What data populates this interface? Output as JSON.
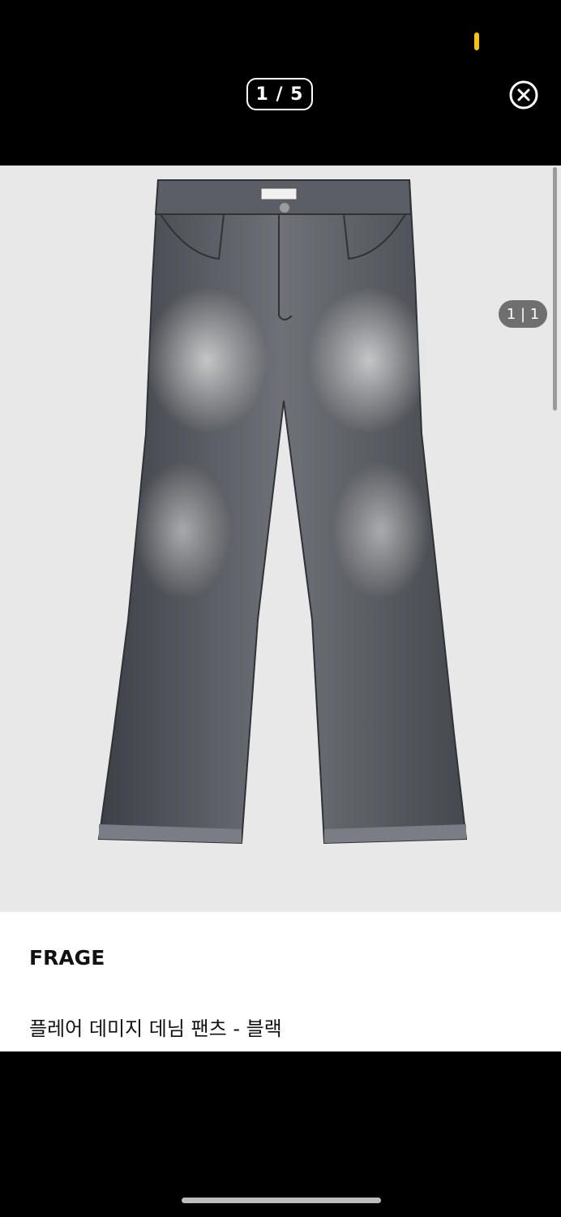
{
  "viewer": {
    "counter": "1 / 5",
    "image_counter": "1 | 1",
    "product_image": "flare-denim-pants-photo"
  },
  "product": {
    "brand": "FRAGE",
    "name": "플레어 데미지 데님 팬츠 - 블랙"
  },
  "icons": {
    "close": "close-circle-icon",
    "status": "status-indicator-icon"
  },
  "colors": {
    "background": "#000000",
    "viewer_background": "#e8e8e8",
    "denim": "#5a5d63",
    "status_accent": "#f5c400"
  }
}
